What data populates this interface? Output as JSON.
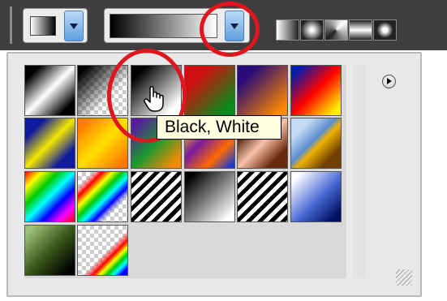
{
  "toolbar": {
    "gradient_swatch_icon": "gradient-swatch-icon",
    "dropdown_arrow_icon": "chevron-down-icon",
    "gradient_types": [
      "linear-gradient-icon",
      "radial-gradient-icon",
      "angle-gradient-icon",
      "reflected-gradient-icon",
      "diamond-gradient-icon"
    ]
  },
  "picker": {
    "menu_icon": "play-icon",
    "resize_icon": "resize-grip-icon",
    "presets": [
      {
        "row": 0,
        "col": 0,
        "style": "foreground-to-background"
      },
      {
        "row": 0,
        "col": 1,
        "style": "foreground-to-transparent"
      },
      {
        "row": 0,
        "col": 2,
        "style": "black-white"
      },
      {
        "row": 0,
        "col": 3,
        "style": "red-green"
      },
      {
        "row": 0,
        "col": 4,
        "style": "violet-orange"
      },
      {
        "row": 0,
        "col": 5,
        "style": "blue-red-yellow"
      },
      {
        "row": 1,
        "col": 0,
        "style": "blue-yellow-blue"
      },
      {
        "row": 1,
        "col": 1,
        "style": "orange-yellow-orange"
      },
      {
        "row": 1,
        "col": 2,
        "style": "violet-green-orange"
      },
      {
        "row": 1,
        "col": 3,
        "style": "yellow-violet-orange-blue"
      },
      {
        "row": 1,
        "col": 4,
        "style": "copper"
      },
      {
        "row": 1,
        "col": 5,
        "style": "chrome"
      },
      {
        "row": 2,
        "col": 0,
        "style": "spectrum"
      },
      {
        "row": 2,
        "col": 1,
        "style": "transparent-rainbow"
      },
      {
        "row": 2,
        "col": 2,
        "style": "transparent-stripes"
      },
      {
        "row": 2,
        "col": 3,
        "style": "neutral-density"
      },
      {
        "row": 2,
        "col": 4,
        "style": "transparent-stripes-2"
      },
      {
        "row": 2,
        "col": 5,
        "style": "blue-white"
      },
      {
        "row": 3,
        "col": 0,
        "style": "green-black"
      },
      {
        "row": 3,
        "col": 1,
        "style": "transparent-rainbow-2"
      }
    ]
  },
  "tooltip": {
    "text": "Black, White"
  },
  "colors": {
    "highlight_circle": "#e0161e",
    "tooltip_bg": "#ffffe1",
    "arrow_button": "#5f9fe0"
  }
}
